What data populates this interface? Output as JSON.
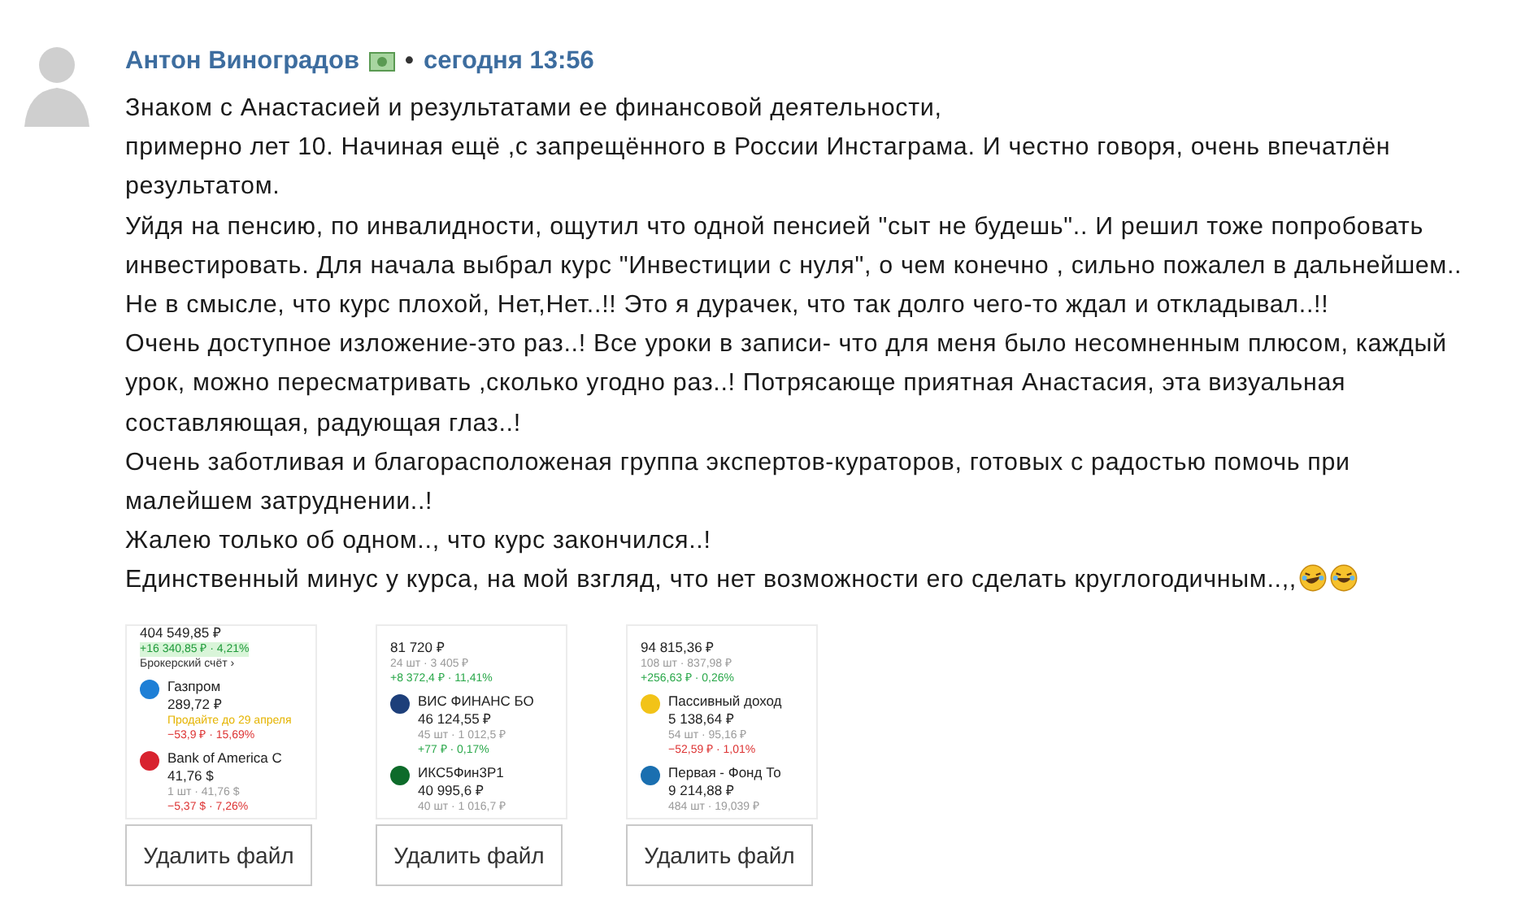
{
  "comment": {
    "author": "Антон Виноградов",
    "separator": "•",
    "time": "сегодня 13:56",
    "paragraphs": [
      "Знаком с Анастасией и результатами ее финансовой деятельности,",
      "примерно лет 10. Начиная ещё ,с запрещённого в России Инстаграма. И честно говоря, очень впечатлён результатом.",
      "Уйдя на пенсию, по инвалидности, ощутил что одной пенсией \"сыт не будешь\".. И решил тоже попробовать инвестировать. Для начала выбрал курс \"Инвестиции с нуля\", о чем конечно , сильно пожалел в дальнейшем.. Не в смысле, что курс плохой, Нет,Нет..!! Это я дурачек, что так долго чего-то ждал и откладывал..!!",
      "Очень доступное изложение-это раз..! Все уроки в записи- что для меня было несомненным плюсом, каждый урок, можно пересматривать ,сколько угодно раз..! Потрясающе приятная Анастасия, эта визуальная составляющая, радующая глаз..!",
      "Очень заботливая и благорасположеная группа экспертов-кураторов, готовых с радостью помочь при малейшем затруднении..!",
      "Жалею только об одном.., что курс закончился..!",
      "Единственный минус у курса, на мой взгляд, что нет возможности его сделать круглогодичным..,,"
    ]
  },
  "attachments": [
    {
      "lines": [
        {
          "kind": "total",
          "text": "404 549,85 ₽"
        },
        {
          "kind": "gain-badge",
          "text": "+16 340,85 ₽ · 4,21%"
        },
        {
          "kind": "link",
          "text": "Брокерский счёт ›"
        }
      ],
      "holdings": [
        {
          "name": "Газпром",
          "color": "#1e7fd6",
          "price": "289,72 ₽",
          "details": [
            {
              "kind": "warn",
              "text": "Продайте до 29 апреля"
            },
            {
              "kind": "loss",
              "text": "−53,9 ₽ · 15,69%"
            }
          ]
        },
        {
          "name": "Bank of America C",
          "color": "#d8232f",
          "price": "41,76 $",
          "details": [
            {
              "kind": "qty",
              "text": "1 шт · 41,76 $"
            },
            {
              "kind": "loss",
              "text": "−5,37 $ · 7,26%"
            }
          ]
        }
      ],
      "button": "Удалить файл"
    },
    {
      "lines": [
        {
          "kind": "price",
          "text": "81 720 ₽"
        },
        {
          "kind": "qty",
          "text": "24 шт · 3 405 ₽"
        },
        {
          "kind": "gain",
          "text": "+8 372,4 ₽ · 11,41%"
        }
      ],
      "holdings": [
        {
          "name": "ВИС ФИНАНС БО",
          "color": "#1d3f7a",
          "price": "46 124,55 ₽",
          "details": [
            {
              "kind": "qty",
              "text": "45 шт · 1 012,5 ₽"
            },
            {
              "kind": "gain",
              "text": "+77 ₽ · 0,17%"
            }
          ]
        },
        {
          "name": "ИКС5Фин3Р1",
          "color": "#0d6b2a",
          "price": "40 995,6 ₽",
          "details": [
            {
              "kind": "qty",
              "text": "40 шт · 1 016,7 ₽"
            }
          ]
        }
      ],
      "button": "Удалить файл"
    },
    {
      "lines": [
        {
          "kind": "price",
          "text": "94 815,36 ₽"
        },
        {
          "kind": "qty",
          "text": "108 шт · 837,98 ₽"
        },
        {
          "kind": "gain",
          "text": "+256,63 ₽ · 0,26%"
        }
      ],
      "holdings": [
        {
          "name": "Пассивный доход",
          "color": "#f2c318",
          "price": "5 138,64 ₽",
          "details": [
            {
              "kind": "qty",
              "text": "54 шт · 95,16 ₽"
            },
            {
              "kind": "loss",
              "text": "−52,59 ₽ · 1,01%"
            }
          ]
        },
        {
          "name": "Первая - Фонд То",
          "color": "#1a6fb0",
          "price": "9 214,88 ₽",
          "details": [
            {
              "kind": "qty",
              "text": "484 шт · 19,039 ₽"
            }
          ]
        }
      ],
      "button": "Удалить файл"
    }
  ]
}
